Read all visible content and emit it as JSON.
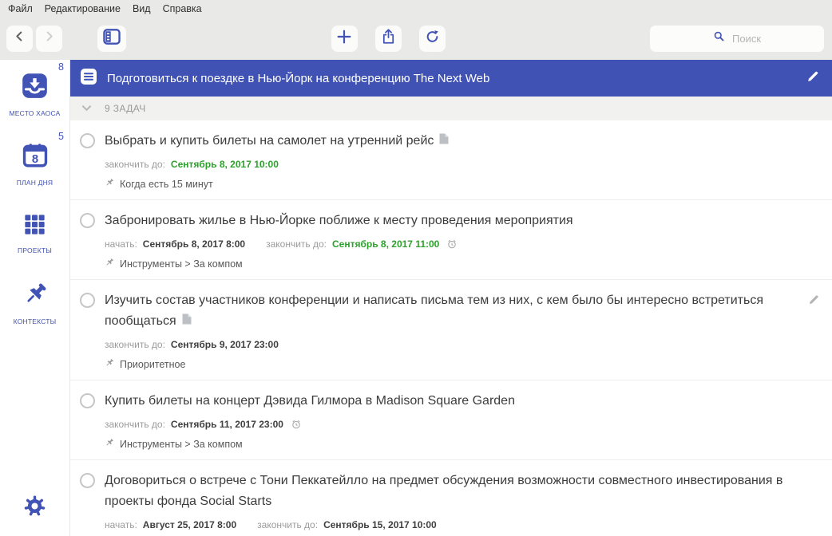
{
  "colors": {
    "accent": "#4153b4",
    "project_header_bg": "#4053b4",
    "due_green": "#2ca12c",
    "chrome_bg": "#e9e9e7",
    "section_bg": "#f1f1ef"
  },
  "menubar": {
    "items": [
      {
        "label": "Файл"
      },
      {
        "label": "Редактирование"
      },
      {
        "label": "Вид"
      },
      {
        "label": "Справка"
      }
    ]
  },
  "toolbar": {
    "icons": [
      "back-icon",
      "forward-icon",
      "sidebar-toggle-icon",
      "add-icon",
      "share-icon",
      "refresh-icon",
      "search-icon"
    ],
    "search_placeholder": "Поиск"
  },
  "sidebar": {
    "items": [
      {
        "label": "МЕСТО ХАОСА",
        "badge": "8",
        "icon": "inbox-icon"
      },
      {
        "label": "ПЛАН ДНЯ",
        "badge": "5",
        "icon": "calendar-icon",
        "calendar_day": "8"
      },
      {
        "label": "ПРОЕКТЫ",
        "badge": "",
        "icon": "grid-icon"
      },
      {
        "label": "КОНТЕКСТЫ",
        "badge": "",
        "icon": "pushpin-icon"
      }
    ],
    "settings_icon": "gear-icon"
  },
  "project": {
    "title": "Подготовиться к поездке в Нью-Йорк на конференцию The Next Web",
    "icon": "list-icon",
    "edit_icon": "pencil-icon"
  },
  "section": {
    "label": "9 ЗАДАЧ"
  },
  "tasks": [
    {
      "title": "Выбрать и купить билеты на самолет на утренний рейс",
      "due_label": "закончить до:",
      "due_value": "Сентябрь 8, 2017 10:00",
      "context": "Когда есть 15 минут"
    },
    {
      "title": "Забронировать жилье в Нью-Йорке поближе к месту проведения мероприятия",
      "start_label": "начать:",
      "start_value": "Сентябрь 8, 2017 8:00",
      "due_label": "закончить до:",
      "due_value": "Сентябрь 8, 2017 11:00",
      "context": "Инструменты > За компом"
    },
    {
      "title": "Изучить состав участников конференции и написать письма тем из них, с кем было бы интересно встретиться пообщаться",
      "due_label": "закончить до:",
      "due_value": "Сентябрь 9, 2017 23:00",
      "context": "Приоритетное"
    },
    {
      "title": "Купить билеты на концерт Дэвида Гилмора в Madison Square Garden",
      "due_label": "закончить до:",
      "due_value": "Сентябрь 11, 2017 23:00",
      "context": "Инструменты > За компом"
    },
    {
      "title": "Договориться о встрече с Тони Пеккатейлло на предмет обсуждения возможности совместного инвестирования в проекты фонда Social Starts",
      "start_label": "начать:",
      "start_value": "Август 25, 2017 8:00",
      "due_label": "закончить до:",
      "due_value": "Сентябрь 15, 2017 10:00"
    }
  ]
}
